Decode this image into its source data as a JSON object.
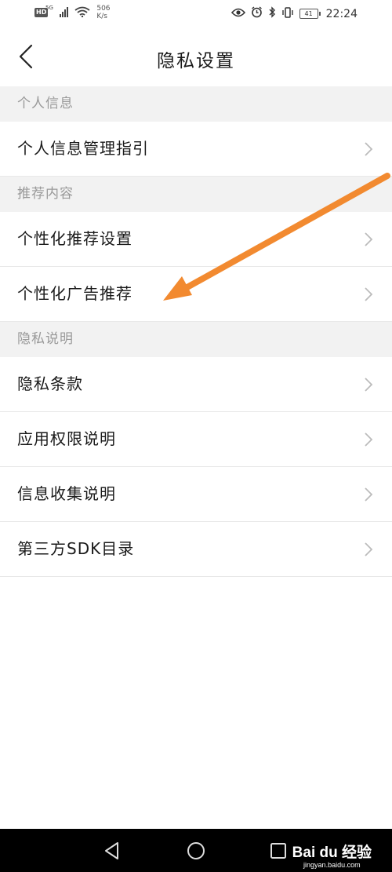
{
  "status_bar": {
    "hd": "HD",
    "network": "5G",
    "speed_value": "506",
    "speed_unit": "K/s",
    "battery": "41",
    "time": "22:24"
  },
  "header": {
    "title": "隐私设置"
  },
  "sections": [
    {
      "header": "个人信息",
      "items": [
        "个人信息管理指引"
      ]
    },
    {
      "header": "推荐内容",
      "items": [
        "个性化推荐设置",
        "个性化广告推荐"
      ]
    },
    {
      "header": "隐私说明",
      "items": [
        "隐私条款",
        "应用权限说明",
        "信息收集说明",
        "第三方SDK目录"
      ]
    }
  ],
  "colors": {
    "section_bg": "#f2f2f2",
    "section_text": "#999999",
    "annotation_arrow": "#f28a30",
    "nav_bar": "#000000"
  },
  "watermark": {
    "main": "Bai du 经验",
    "sub": "jingyan.baidu.com"
  }
}
